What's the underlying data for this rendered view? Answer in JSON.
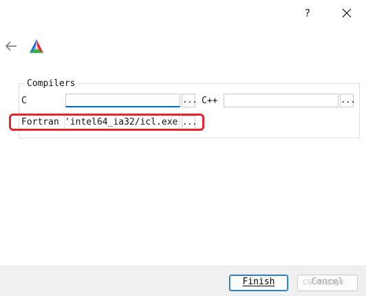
{
  "window": {
    "help_label": "?",
    "close_icon": "close-icon"
  },
  "nav": {
    "back_icon": "arrow-left-icon",
    "logo_icon": "cmake-triangle-logo-icon"
  },
  "compilers": {
    "title": "Compilers",
    "c": {
      "label": "C",
      "value": "",
      "browse_label": "..."
    },
    "cpp": {
      "label": "C++",
      "value": "",
      "browse_label": "..."
    },
    "fortran": {
      "label": "Fortran",
      "value": "'intel64_ia32/icl.exe",
      "browse_label": "..."
    }
  },
  "footer": {
    "finish_label": "Finish",
    "cancel_label": "Cancel",
    "watermark": "CSDN @tiyY"
  },
  "colors": {
    "accent": "#0067c0",
    "highlight_red": "#e8232b",
    "footer_bg": "#f0f0f0"
  }
}
